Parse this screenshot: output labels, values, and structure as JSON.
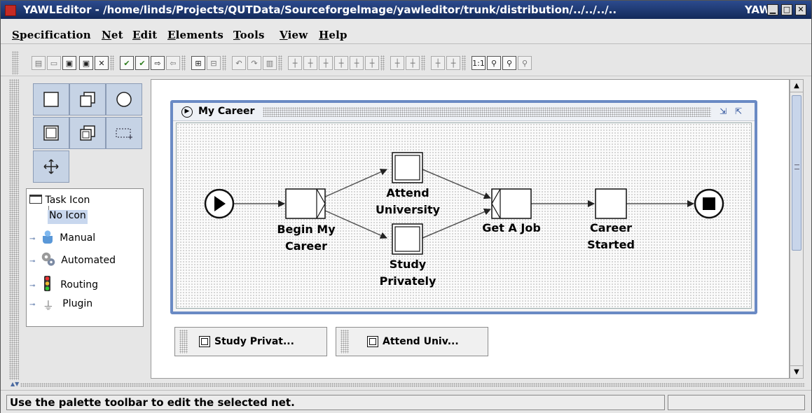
{
  "window": {
    "title": "YAWLEditor - /home/linds/Projects/QUTData/Sourceforgelmage/yawleditor/trunk/distribution/../../../..",
    "title_tail": "YAW"
  },
  "menu": [
    "Specification",
    "Net",
    "Edit",
    "Elements",
    "Tools",
    "View",
    "Help"
  ],
  "toolbar": {
    "icons": [
      "new-spec-icon",
      "open-spec-icon",
      "save-icon",
      "save-as-icon",
      "close-spec-icon",
      "validate-icon",
      "analyse-icon",
      "export-icon",
      "import-icon",
      "add-net-icon",
      "remove-net-icon",
      "undo-icon",
      "redo-icon",
      "delete-icon",
      "align-top-icon",
      "align-center-icon",
      "align-bottom-icon",
      "align-left-icon",
      "align-middle-icon",
      "align-right-icon",
      "increase-size-icon",
      "decrease-size-icon",
      "cancellation-add-icon",
      "cancellation-remove-icon",
      "zoom-actual-icon",
      "zoom-out-icon",
      "zoom-in-icon",
      "zoom-selection-icon"
    ]
  },
  "palette": {
    "tools": [
      "atomic-task-tool",
      "multi-atomic-task-tool",
      "condition-tool",
      "composite-task-tool",
      "multi-composite-task-tool",
      "marquee-tool",
      "navigate-tool"
    ]
  },
  "icon_tree": {
    "root": "Task Icon",
    "selected": "No Icon",
    "items": [
      "Manual",
      "Automated",
      "Routing",
      "Plugin"
    ]
  },
  "net": {
    "name": "My Career",
    "tasks": {
      "begin": "Begin My Career",
      "begin_l1": "Begin My",
      "begin_l2": "Career",
      "attend_l1": "Attend",
      "attend_l2": "University",
      "study_l1": "Study",
      "study_l2": "Privately",
      "job": "Get A Job",
      "started_l1": "Career",
      "started_l2": "Started"
    }
  },
  "minimized_nets": [
    "Study Privat...",
    "Attend Univ..."
  ],
  "status": {
    "message": "Use the palette toolbar to edit the selected net.",
    "aux": ""
  }
}
